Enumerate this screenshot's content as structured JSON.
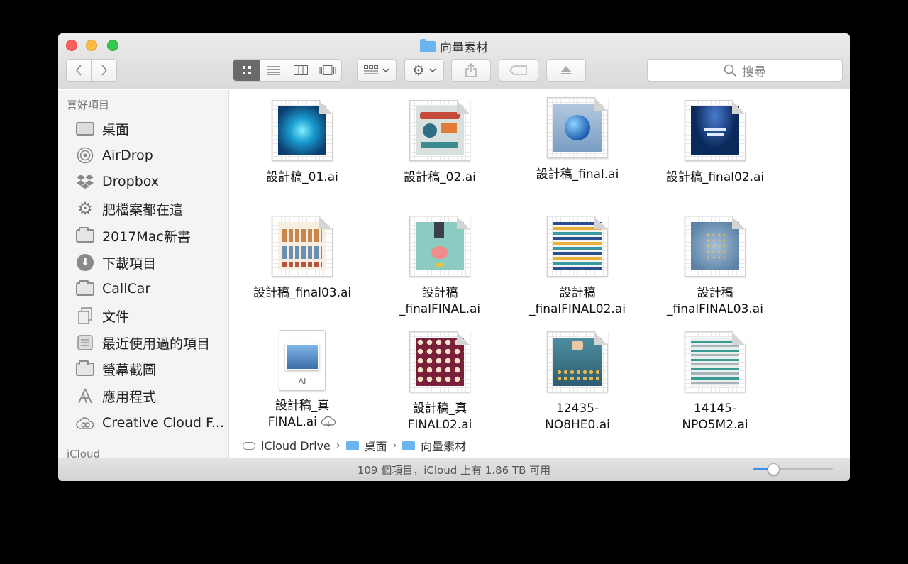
{
  "window": {
    "title": "向量素材"
  },
  "toolbar": {
    "back_icon": "chevron-left-icon",
    "forward_icon": "chevron-right-icon",
    "view_modes": [
      "icon-view",
      "list-view",
      "column-view",
      "cover-flow-view"
    ],
    "active_view": "icon-view",
    "search_placeholder": "搜尋"
  },
  "sidebar": {
    "favorites_header": "喜好項目",
    "items": [
      {
        "label": "桌面",
        "icon": "desktop-icon"
      },
      {
        "label": "AirDrop",
        "icon": "airdrop-icon"
      },
      {
        "label": "Dropbox",
        "icon": "dropbox-icon"
      },
      {
        "label": "肥檔案都在這",
        "icon": "gear-folder-icon"
      },
      {
        "label": "2017Mac新書",
        "icon": "folder-icon"
      },
      {
        "label": "下載項目",
        "icon": "download-icon"
      },
      {
        "label": "CallCar",
        "icon": "folder-icon"
      },
      {
        "label": "文件",
        "icon": "documents-icon"
      },
      {
        "label": "最近使用過的項目",
        "icon": "recents-icon"
      },
      {
        "label": "螢幕截圖",
        "icon": "folder-icon"
      },
      {
        "label": "應用程式",
        "icon": "applications-icon"
      },
      {
        "label": "Creative Cloud F...",
        "icon": "creative-cloud-icon"
      }
    ],
    "icloud_header": "iCloud"
  },
  "files": [
    {
      "name": "設計稿_01.ai",
      "art": "#1a7fb5"
    },
    {
      "name": "設計稿_02.ai",
      "art": "#cfd8d6"
    },
    {
      "name": "設計稿_final.ai",
      "art": "#7a9cc4"
    },
    {
      "name": "設計稿_final02.ai",
      "art": "#0b2a5c"
    },
    {
      "name": "設計稿_final03.ai",
      "art": "#f2e6d2"
    },
    {
      "name": "設計稿\n_finalFINAL.ai",
      "art": "#8ccbc1"
    },
    {
      "name": "設計稿\n_finalFINAL02.ai",
      "art": "#f4f4f4"
    },
    {
      "name": "設計稿\n_finalFINAL03.ai",
      "art": "#6f93b3"
    },
    {
      "name": "設計稿_真\nFINAL.ai",
      "art": "generic-ai"
    },
    {
      "name": "設計稿_真\nFINAL02.ai",
      "art": "#7a1f3a"
    },
    {
      "name": "12435-\nNO8HE0.ai",
      "art": "#2e5d73"
    },
    {
      "name": "14145-\nNPO5M2.ai",
      "art": "#e9efee"
    }
  ],
  "pathbar": [
    "iCloud Drive",
    "桌面",
    "向量素材"
  ],
  "status": {
    "text": "109 個項目，iCloud 上有 1.86 TB 可用",
    "zoom_level": 0.25
  },
  "colors": {
    "accent": "#3b8cf3",
    "folder": "#6cb4f0"
  }
}
